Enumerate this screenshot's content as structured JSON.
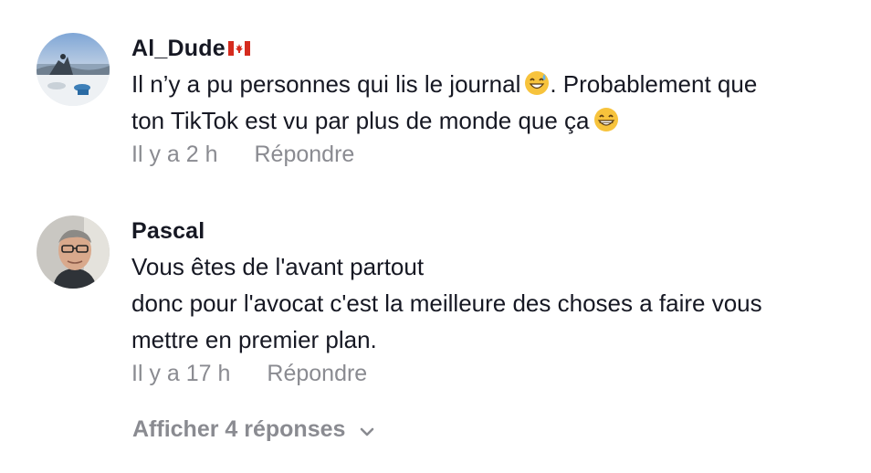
{
  "comments": [
    {
      "username": "Al_Dude",
      "flag_icon": "canada-flag-icon",
      "lines": [
        "Il n’y a pu personnes qui lis le journal",
        ". Probablement que",
        "ton TikTok est vu par plus de monde que ça"
      ],
      "emoji_1": "sweat-smile-emoji",
      "emoji_2": "grinning-emoji",
      "time": "Il y a 2 h",
      "reply_label": "Répondre"
    },
    {
      "username": "Pascal",
      "lines": [
        "Vous êtes de l'avant partout",
        "donc pour l'avocat c'est la meilleure des choses a faire vous",
        "mettre en premier plan."
      ],
      "time": "Il y a 17 h",
      "reply_label": "Répondre"
    }
  ],
  "show_replies_label": "Afficher 4 réponses",
  "show_replies_icon": "chevron-down-icon",
  "colors": {
    "primary_text": "#161823",
    "secondary_text": "#8a8b91",
    "background": "#ffffff"
  }
}
